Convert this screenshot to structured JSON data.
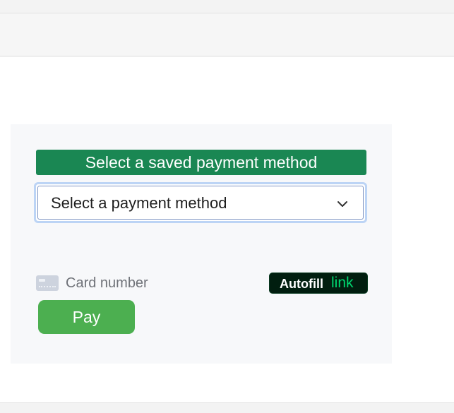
{
  "payment": {
    "saved_method_label": "Select a saved payment method",
    "method_select": {
      "selected": "Select a payment method"
    },
    "card_number_placeholder": "Card number",
    "autofill": {
      "label": "Autofill",
      "brand": "link"
    },
    "pay_label": "Pay"
  },
  "colors": {
    "saved_label_bg": "#1a8753",
    "pay_button_bg": "#4caf50",
    "link_button_bg": "#011e0f",
    "link_brand_text": "#00d66f",
    "select_focus_ring": "#bcd4f5"
  },
  "icons": {
    "select_arrow": "chevron-down-icon",
    "card": "credit-card-icon"
  }
}
